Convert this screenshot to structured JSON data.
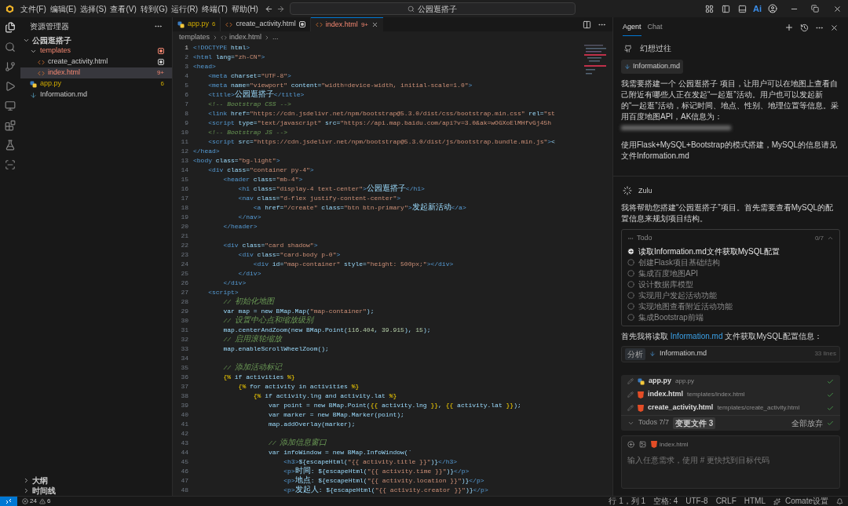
{
  "title_bar": {
    "menus": [
      "文件(F)",
      "编辑(E)",
      "选择(S)",
      "查看(V)",
      "转到(G)",
      "运行(R)",
      "终端(T)",
      "帮助(H)"
    ],
    "search": "公园逛搭子",
    "ai_button": "Ai"
  },
  "activity_bar": {
    "items": [
      {
        "kind": "files",
        "selected": true
      },
      {
        "kind": "search",
        "selected": false
      },
      {
        "kind": "git",
        "selected": false
      },
      {
        "kind": "run",
        "selected": false
      },
      {
        "kind": "remote",
        "selected": false
      },
      {
        "kind": "extensions",
        "selected": false
      },
      {
        "kind": "testing",
        "selected": false
      },
      {
        "kind": "scan",
        "selected": false
      }
    ]
  },
  "explorer": {
    "title": "资源管理器",
    "project": {
      "name": "公园逛搭子",
      "expanded": true,
      "children": [
        {
          "name": "templates",
          "kind": "folder",
          "has_errors": true,
          "has_warnings": false,
          "modified": true,
          "expanded": true,
          "selected": false,
          "children": [
            {
              "name": "create_activity.html",
              "kind": "html",
              "has_errors": false,
              "has_warnings": false,
              "modified": true,
              "selected": false
            },
            {
              "name": "index.html",
              "kind": "html",
              "has_errors": true,
              "has_warnings": false,
              "badge": "9+",
              "modified": false,
              "selected": true
            }
          ]
        },
        {
          "name": "app.py",
          "kind": "python",
          "has_errors": false,
          "has_warnings": true,
          "badge": "6",
          "modified": false,
          "selected": false
        },
        {
          "name": "Information.md",
          "kind": "markdown",
          "has_errors": false,
          "has_warnings": false,
          "modified": false,
          "selected": false
        }
      ]
    },
    "sections": [
      {
        "title": "大纲",
        "expanded": false
      },
      {
        "title": "时间线",
        "expanded": false
      }
    ]
  },
  "editor": {
    "tabs": [
      {
        "name": "app.py",
        "kind": "python",
        "has_errors": false,
        "has_warnings": true,
        "badge": "6",
        "modified": false,
        "selected": false
      },
      {
        "name": "create_activity.html",
        "kind": "html",
        "has_errors": false,
        "has_warnings": false,
        "modified": true,
        "selected": false
      },
      {
        "name": "index.html",
        "kind": "html",
        "has_errors": true,
        "has_warnings": false,
        "badge": "9+",
        "modified": false,
        "selected": true
      }
    ],
    "breadcrumb": [
      "templates",
      "index.html",
      "..."
    ],
    "lines": [
      {
        "n": "1",
        "code": "<!DOCTYPE html>"
      },
      {
        "n": "2",
        "code": "<html lang=\"zh-CN\">"
      },
      {
        "n": "3",
        "code": "<head>"
      },
      {
        "n": "4",
        "code": "    <meta charset=\"UTF-8\">"
      },
      {
        "n": "5",
        "code": "    <meta name=\"viewport\" content=\"width=device-width, initial-scale=1.0\">"
      },
      {
        "n": "6",
        "code": "    <title>公园逛搭子</title>"
      },
      {
        "n": "7",
        "code": "    <!-- Bootstrap CSS -->"
      },
      {
        "n": "8",
        "code": "    <link href=\"https://cdn.jsdelivr.net/npm/bootstrap@5.3.0/dist/css/bootstrap.min.css\" rel=\"st"
      },
      {
        "n": "9",
        "code": "    <script type=\"text/javascript\" src=\"https://api.map.baidu.com/api?v=3.0&ak=wOGXoElMHfvGj45h"
      },
      {
        "n": "10",
        "code": "    <!-- Bootstrap JS -->"
      },
      {
        "n": "11",
        "code": "    <script src=\"https://cdn.jsdelivr.net/npm/bootstrap@5.3.0/dist/js/bootstrap.bundle.min.js\"><"
      },
      {
        "n": "12",
        "code": "</head>"
      },
      {
        "n": "13",
        "code": "<body class=\"bg-light\">"
      },
      {
        "n": "14",
        "code": "    <div class=\"container py-4\">"
      },
      {
        "n": "15",
        "code": "        <header class=\"mb-4\">"
      },
      {
        "n": "16",
        "code": "            <h1 class=\"display-4 text-center\">公园逛搭子</h1>"
      },
      {
        "n": "17",
        "code": "            <nav class=\"d-flex justify-content-center\">"
      },
      {
        "n": "18",
        "code": "                <a href=\"/create\" class=\"btn btn-primary\">发起新活动</a>"
      },
      {
        "n": "19",
        "code": "            </nav>"
      },
      {
        "n": "20",
        "code": "        </header>"
      },
      {
        "n": "21"
      },
      {
        "n": "22",
        "code": "        <div class=\"card shadow\">"
      },
      {
        "n": "23",
        "code": "            <div class=\"card-body p-0\">"
      },
      {
        "n": "24",
        "code": "                <div id=\"map-container\" style=\"height: 500px;\"></div>"
      },
      {
        "n": "25",
        "code": "            </div>"
      },
      {
        "n": "26",
        "code": "        </div>"
      },
      {
        "n": "27",
        "code": "    <script>"
      },
      {
        "n": "28",
        "code": "        // 初始化地图"
      },
      {
        "n": "29",
        "code": "        var map = new BMap.Map(\"map-container\");"
      },
      {
        "n": "30",
        "code": "        // 设置中心点和缩放级别"
      },
      {
        "n": "31",
        "code": "        map.centerAndZoom(new BMap.Point(116.404, 39.915), 15);"
      },
      {
        "n": "32",
        "code": "        // 启用滚轮缩放"
      },
      {
        "n": "33",
        "code": "        map.enableScrollWheelZoom();"
      },
      {
        "n": "34"
      },
      {
        "n": "35",
        "code": "        // 添加活动标记"
      },
      {
        "n": "36",
        "code": "        {% if activities %}"
      },
      {
        "n": "37",
        "code": "            {% for activity in activities %}"
      },
      {
        "n": "38",
        "code": "                {% if activity.lng and activity.lat %}"
      },
      {
        "n": "39",
        "code": "                    var point = new BMap.Point({{ activity.lng }}, {{ activity.lat }});"
      },
      {
        "n": "40",
        "code": "                    var marker = new BMap.Marker(point);"
      },
      {
        "n": "41",
        "code": "                    map.addOverlay(marker);"
      },
      {
        "n": "42"
      },
      {
        "n": "43",
        "code": "                    // 添加信息窗口"
      },
      {
        "n": "44",
        "code": "                    var infoWindow = new BMap.InfoWindow(`"
      },
      {
        "n": "45",
        "code": "                        <h3>${escapeHtml(\"{{ activity.title }}\")}</h3>"
      },
      {
        "n": "46",
        "code": "                        <p>时间: ${escapeHtml(\"{{ activity.time }}\")}</p>"
      },
      {
        "n": "47",
        "code": "                        <p>地点: ${escapeHtml(\"{{ activity.location }}\")}</p>"
      },
      {
        "n": "48",
        "code": "                        <p>发起人: ${escapeHtml(\"{{ activity.creator }}\")}</p>"
      }
    ]
  },
  "assistant": {
    "tabs": [
      {
        "label": "Agent",
        "selected": true
      },
      {
        "label": "Chat",
        "selected": false
      }
    ],
    "user_message": {
      "author": "幻想过往",
      "attachment": "Information.md",
      "paragraphs": [
        "我需要搭建一个 公园逛搭子 项目，让用户可以在地图上查看自己附近有哪些人正在发起“一起逛”活动。用户也可以发起新的“一起逛”活动，标记时间、地点、性别、地理位置等信息。采用百度地图API，AK信息为：",
        "使用Flask+MySQL+Bootstrap的模式搭建，MySQL的信息请见文件Information.md"
      ],
      "redacted": true
    },
    "reply": {
      "author": "Zulu",
      "text": "我将帮助您搭建“公园逛搭子”项目。首先需要查看MySQL的配置信息来规划项目结构。",
      "todo": {
        "title": "Todo",
        "count": "0/7",
        "expanded": true,
        "items": [
          {
            "text": "读取Information.md文件获取MySQL配置",
            "in_progress": true
          },
          {
            "text": "创建Flask项目基础结构",
            "in_progress": false
          },
          {
            "text": "集成百度地图API",
            "in_progress": false
          },
          {
            "text": "设计数据库模型",
            "in_progress": false
          },
          {
            "text": "实现用户发起活动功能",
            "in_progress": false
          },
          {
            "text": "实现地图查看附近活动功能",
            "in_progress": false
          },
          {
            "text": "集成Bootstrap前端",
            "in_progress": false
          }
        ]
      },
      "read_note": {
        "before": "首先我将读取 ",
        "link": "Information.md",
        "after": " 文件获取MySQL配置信息："
      },
      "tool_call": {
        "action": "分析",
        "file": "Information.md",
        "size": "33 lines"
      }
    },
    "changes": {
      "files": [
        {
          "name": "app.py",
          "path": "app.py",
          "kind": "python",
          "accepted": true
        },
        {
          "name": "index.html",
          "path": "templates/index.html",
          "kind": "html",
          "accepted": true
        },
        {
          "name": "create_activity.html",
          "path": "templates/create_activity.html",
          "kind": "html",
          "accepted": true
        }
      ],
      "todos": "Todos 7/7",
      "changed_files": "变更文件 3",
      "discard_all": "全部放弃"
    },
    "input": {
      "context_file": "index.html",
      "placeholder": "输入任意需求，使用 # 更快找到目标代码"
    }
  },
  "status_bar": {
    "errors": "24",
    "warnings": "6",
    "items": [
      "行 1，列 1",
      "空格: 4",
      "UTF-8",
      "CRLF",
      "HTML"
    ],
    "comate": "Comate设置"
  }
}
